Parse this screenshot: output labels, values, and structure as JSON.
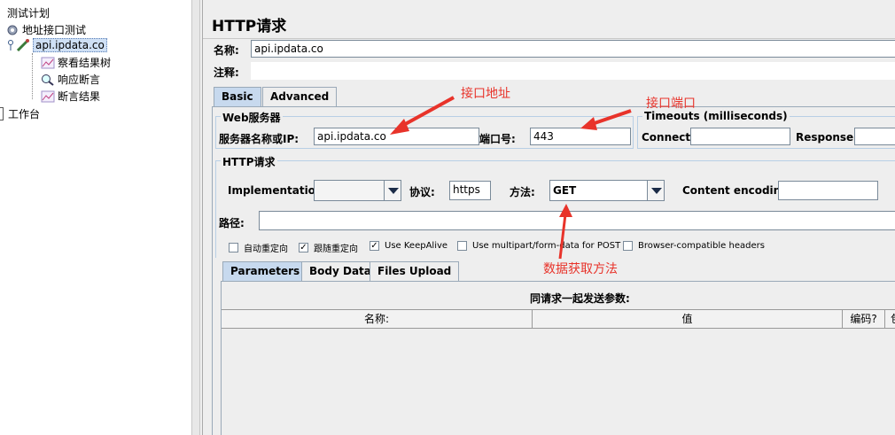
{
  "tree": {
    "root": "测试计划",
    "thread_group": "地址接口测试",
    "sampler": "api.ipdata.co",
    "children": [
      "察看结果树",
      "响应断言",
      "断言结果"
    ],
    "workbench": "工作台"
  },
  "panel": {
    "title": "HTTP请求",
    "name_label": "名称:",
    "name_value": "api.ipdata.co",
    "comment_label": "注释:",
    "tabs": [
      "Basic",
      "Advanced"
    ],
    "web_server": {
      "title": "Web服务器",
      "server_label": "服务器名称或IP:",
      "server_value": "api.ipdata.co",
      "port_label": "端口号:",
      "port_value": "443"
    },
    "timeouts": {
      "title": "Timeouts (milliseconds)",
      "connect_label": "Connect:",
      "response_label": "Response:"
    },
    "http": {
      "title": "HTTP请求",
      "implementation_label": "Implementation:",
      "protocol_label": "协议:",
      "protocol_value": "https",
      "method_label": "方法:",
      "method_value": "GET",
      "encoding_label": "Content encoding:",
      "path_label": "路径:"
    },
    "checkboxes": [
      {
        "label": "自动重定向",
        "checked": false
      },
      {
        "label": "跟随重定向",
        "checked": true
      },
      {
        "label": "Use KeepAlive",
        "checked": true
      },
      {
        "label": "Use multipart/form-data for POST",
        "checked": false
      },
      {
        "label": "Browser-compatible headers",
        "checked": false
      }
    ],
    "param_tabs": [
      "Parameters",
      "Body Data",
      "Files Upload"
    ],
    "params_caption": "同请求一起发送参数:",
    "columns": [
      "名称:",
      "值",
      "编码?",
      "包"
    ]
  },
  "annotations": {
    "address": "接口地址",
    "port": "接口端口",
    "method": "数据获取方法"
  },
  "colors": {
    "annotation": "#e8332a",
    "active_tab": "#c7d9ee"
  }
}
